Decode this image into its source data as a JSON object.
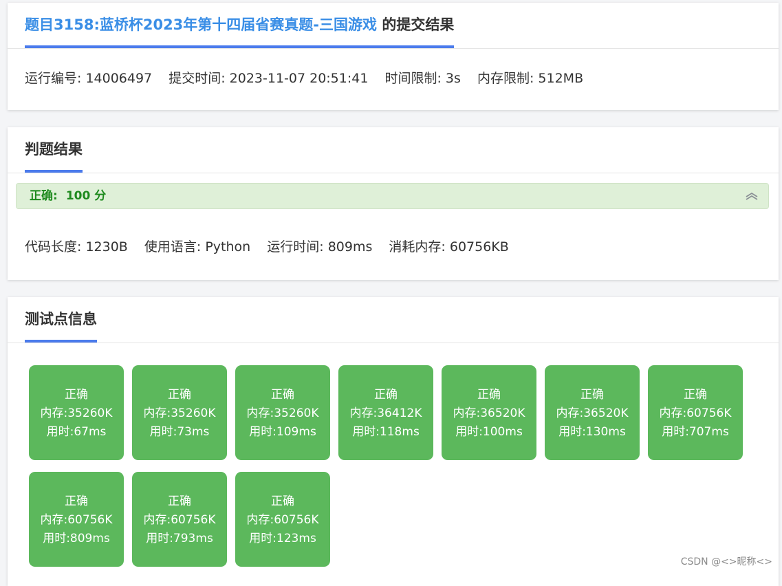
{
  "submission": {
    "title_link": "题目3158:蓝桥杯2023年第十四届省赛真题-三国游戏",
    "title_suffix": " 的提交结果",
    "run_id": "运行编号: 14006497",
    "submit_time": "提交时间: 2023-11-07 20:51:41",
    "time_limit": "时间限制: 3s",
    "memory_limit": "内存限制: 512MB"
  },
  "judge": {
    "header": "判题结果",
    "status_label": "正确:",
    "score": "100 分",
    "status_color": "#1e8a1e",
    "bar_color": "#dff0d8",
    "code_length": "代码长度: 1230B",
    "language": "使用语言: Python",
    "run_time": "运行时间: 809ms",
    "memory_used": "消耗内存: 60756KB"
  },
  "tests": {
    "header": "测试点信息",
    "box_color": "#5cb85c",
    "items": [
      {
        "status": "正确",
        "memory": "内存:35260K",
        "time": "用时:67ms"
      },
      {
        "status": "正确",
        "memory": "内存:35260K",
        "time": "用时:73ms"
      },
      {
        "status": "正确",
        "memory": "内存:35260K",
        "time": "用时:109ms"
      },
      {
        "status": "正确",
        "memory": "内存:36412K",
        "time": "用时:118ms"
      },
      {
        "status": "正确",
        "memory": "内存:36520K",
        "time": "用时:100ms"
      },
      {
        "status": "正确",
        "memory": "内存:36520K",
        "time": "用时:130ms"
      },
      {
        "status": "正确",
        "memory": "内存:60756K",
        "time": "用时:707ms"
      },
      {
        "status": "正确",
        "memory": "内存:60756K",
        "time": "用时:809ms"
      },
      {
        "status": "正确",
        "memory": "内存:60756K",
        "time": "用时:793ms"
      },
      {
        "status": "正确",
        "memory": "内存:60756K",
        "time": "用时:123ms"
      }
    ]
  },
  "accent_color": "#4b7bec",
  "watermark": "CSDN @<>昵称<>"
}
